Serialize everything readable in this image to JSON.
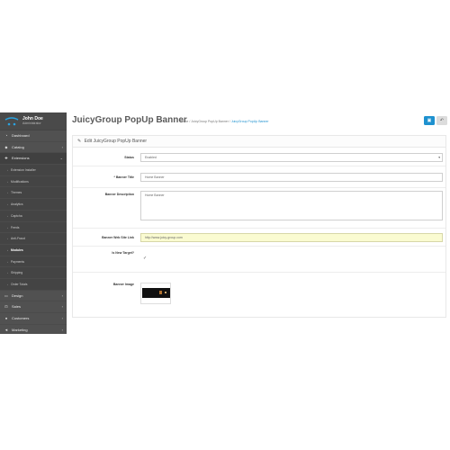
{
  "user": {
    "name": "John Doe",
    "role": "Administrator"
  },
  "sidebar": {
    "items": [
      {
        "icon": "dashboard-icon",
        "glyph": "◔",
        "label": "Dashboard",
        "has_chevron": false
      },
      {
        "icon": "tag-icon",
        "glyph": "◆",
        "label": "Catalog",
        "has_chevron": true
      },
      {
        "icon": "puzzle-icon",
        "glyph": "✚",
        "label": "Extensions",
        "has_chevron": true,
        "expanded": true
      }
    ],
    "subitems": [
      {
        "label": "Extension Installer"
      },
      {
        "label": "Modifications"
      },
      {
        "label": "Themes"
      },
      {
        "label": "Analytics"
      },
      {
        "label": "Captcha"
      },
      {
        "label": "Feeds"
      },
      {
        "label": "Anti-Fraud"
      },
      {
        "label": "Modules",
        "current": true
      },
      {
        "label": "Payments"
      },
      {
        "label": "Shipping"
      },
      {
        "label": "Order Totals"
      }
    ],
    "bottom_items": [
      {
        "icon": "desktop-icon",
        "glyph": "▭",
        "label": "Design"
      },
      {
        "icon": "cart-icon",
        "glyph": "⊡",
        "label": "Sales"
      },
      {
        "icon": "users-icon",
        "glyph": "●",
        "label": "Customers"
      },
      {
        "icon": "share-icon",
        "glyph": "◄",
        "label": "Marketing"
      }
    ]
  },
  "header": {
    "title": "JuicyGroup PopUp Banner",
    "breadcrumb": [
      "Home",
      "JuicyGroup PopUp Banner",
      "JuicyGroup PopUp Banner"
    ],
    "save_glyph": "▣",
    "back_glyph": "↶"
  },
  "form": {
    "panel_title": "Edit JuicyGroup PopUp Banner",
    "status": {
      "label": "Status",
      "value": "Enabled"
    },
    "banner_title": {
      "label": "* Banner Title",
      "value": "Home Banner"
    },
    "banner_description": {
      "label": "Banner Description",
      "value": "Home Banner"
    },
    "banner_link": {
      "label": "Banner Web Site Link",
      "value": "http://www.juicy-group.com"
    },
    "new_target": {
      "label": "Is New Target?",
      "checked_glyph": "✓"
    },
    "banner_image": {
      "label": "Banner Image"
    }
  },
  "colors": {
    "sidebar_bg": "#515151",
    "accent_blue": "#1e91cf",
    "link_field_bg": "#fafbd1"
  }
}
